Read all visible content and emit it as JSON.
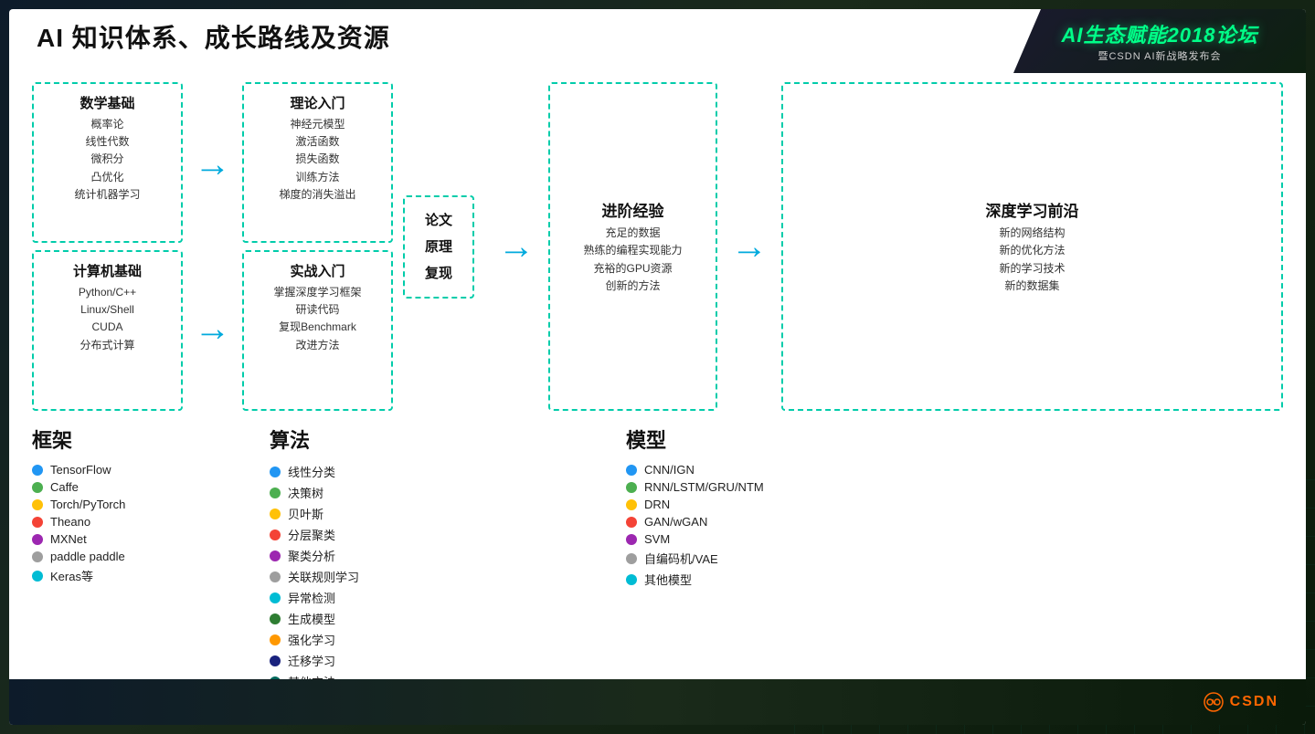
{
  "header": {
    "title": "AI 知识体系、成长路线及资源"
  },
  "logo": {
    "main": "AI生态赋能2018论坛",
    "sub": "暨CSDN AI新战略发布会"
  },
  "flow": {
    "math_box": {
      "title1": "数学基础",
      "items1": [
        "概率论",
        "线性代数",
        "微积分",
        "凸优化",
        "统计机器学习"
      ],
      "title2": "计算机基础",
      "items2": [
        "Python/C++",
        "Linux/Shell",
        "CUDA",
        "分布式计算"
      ]
    },
    "theory_box": {
      "title1": "理论入门",
      "items1": [
        "神经元模型",
        "激活函数",
        "损失函数",
        "训练方法",
        "梯度的消失溢出"
      ],
      "title2": "实战入门",
      "items2": [
        "掌握深度学习框架",
        "研读代码",
        "复现Benchmark",
        "改进方法"
      ]
    },
    "paper_box": {
      "lines": [
        "论文",
        "原理",
        "复现"
      ]
    },
    "advanced_box": {
      "title": "进阶经验",
      "items": [
        "充足的数据",
        "熟练的编程实现能力",
        "充裕的GPU资源",
        "创新的方法"
      ]
    },
    "deep_box": {
      "title": "深度学习前沿",
      "items": [
        "新的网络结构",
        "新的优化方法",
        "新的学习技术",
        "新的数据集"
      ]
    }
  },
  "legends": {
    "frameworks": {
      "title": "框架",
      "items": [
        {
          "label": "TensorFlow",
          "color": "#2196F3"
        },
        {
          "label": "Caffe",
          "color": "#4CAF50"
        },
        {
          "label": "Torch/PyTorch",
          "color": "#FFC107"
        },
        {
          "label": "Theano",
          "color": "#F44336"
        },
        {
          "label": "MXNet",
          "color": "#9C27B0"
        },
        {
          "label": "paddle paddle",
          "color": "#9E9E9E"
        },
        {
          "label": "Keras等",
          "color": "#00BCD4"
        }
      ]
    },
    "algorithms": {
      "title": "算法",
      "items": [
        {
          "label": "线性分类",
          "color": "#2196F3"
        },
        {
          "label": "决策树",
          "color": "#4CAF50"
        },
        {
          "label": "贝叶斯",
          "color": "#FFC107"
        },
        {
          "label": "分层聚类",
          "color": "#F44336"
        },
        {
          "label": "聚类分析",
          "color": "#9C27B0"
        },
        {
          "label": "关联规则学习",
          "color": "#9E9E9E"
        },
        {
          "label": "异常检测",
          "color": "#00BCD4"
        },
        {
          "label": "生成模型",
          "color": "#2E7D32"
        },
        {
          "label": "强化学习",
          "color": "#FF9800"
        },
        {
          "label": "迁移学习",
          "color": "#1A237E"
        },
        {
          "label": "其他方法",
          "color": "#00695C"
        }
      ]
    },
    "models": {
      "title": "模型",
      "items": [
        {
          "label": "CNN/IGN",
          "color": "#2196F3"
        },
        {
          "label": "RNN/LSTM/GRU/NTM",
          "color": "#4CAF50"
        },
        {
          "label": "DRN",
          "color": "#FFC107"
        },
        {
          "label": "GAN/wGAN",
          "color": "#F44336"
        },
        {
          "label": "SVM",
          "color": "#9C27B0"
        },
        {
          "label": "自编码机/VAE",
          "color": "#9E9E9E"
        },
        {
          "label": "其他模型",
          "color": "#00BCD4"
        }
      ]
    }
  },
  "csdn": {
    "label": "CSDN"
  }
}
